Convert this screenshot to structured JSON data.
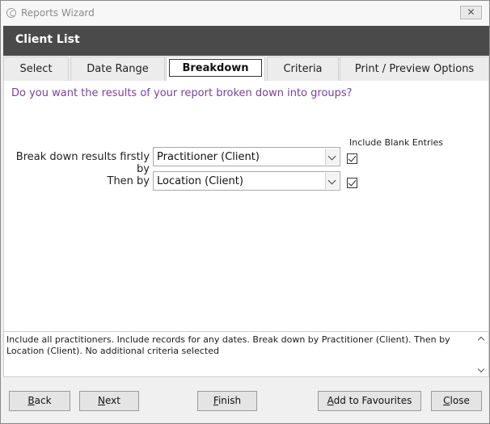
{
  "window": {
    "title": "Reports Wizard",
    "close_label": "✕"
  },
  "header": {
    "title": "Client List"
  },
  "tabs": [
    {
      "label": "Select",
      "active": false
    },
    {
      "label": "Date Range",
      "active": false
    },
    {
      "label": "Breakdown",
      "active": true
    },
    {
      "label": "Criteria",
      "active": false
    },
    {
      "label": "Print / Preview Options",
      "active": false
    }
  ],
  "breakdown": {
    "question": "Do you want the results of your report broken down into groups?",
    "include_blank_header": "Include Blank Entries",
    "rows": [
      {
        "label": "Break down results firstly by",
        "value": "Practitioner (Client)",
        "include_blank": true
      },
      {
        "label": "Then by",
        "value": "Location (Client)",
        "include_blank": true
      }
    ]
  },
  "summary": {
    "text": "Include all practitioners. Include records for any dates. Break down by Practitioner (Client). Then by Location (Client). No additional criteria selected"
  },
  "buttons": {
    "back": "Back",
    "next": "Next",
    "finish": "Finish",
    "add_to_favourites": "Add to Favourites",
    "close": "Close"
  },
  "colors": {
    "header_bg": "#4a4a4a",
    "question_text": "#7b3fa0"
  }
}
